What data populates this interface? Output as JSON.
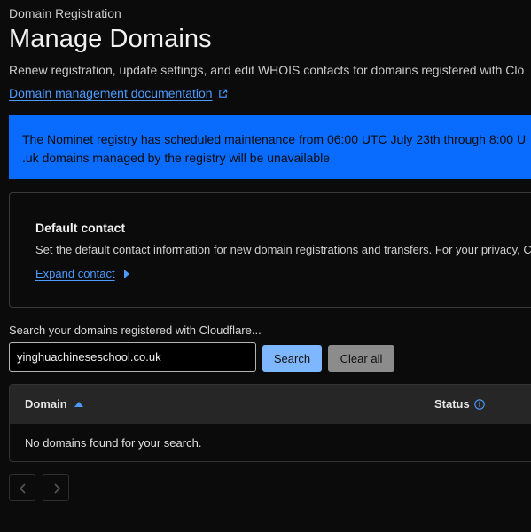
{
  "header": {
    "breadcrumb": "Domain Registration",
    "title": "Manage Domains",
    "description": "Renew registration, update settings, and edit WHOIS contacts for domains registered with Clo",
    "doc_link": "Domain management documentation",
    "doc_link_icon": "external-link-icon"
  },
  "banner": {
    "line1": "The Nominet registry has scheduled maintenance from 06:00 UTC July 23th through 8:00 U",
    "line2": ".uk domains managed by the registry will be unavailable",
    "color": "#0a6cff"
  },
  "default_contact": {
    "heading": "Default contact",
    "text": "Set the default contact information for new domain registrations and transfers. For your privacy, Clou",
    "expand_label": "Expand contact",
    "expand_icon": "caret-right-icon"
  },
  "search": {
    "label": "Search your domains registered with Cloudflare...",
    "value": "yinghuachineseschool.co.uk",
    "search_button": "Search",
    "clear_button": "Clear all"
  },
  "table": {
    "columns": [
      "Domain",
      "Status"
    ],
    "sort_icon": "sort-ascending-icon",
    "status_icon": "info-icon",
    "empty_message": "No domains found for your search."
  },
  "pagination": {
    "prev_icon": "chevron-left-icon",
    "next_icon": "chevron-right-icon"
  },
  "colors": {
    "accent": "#4d9bff",
    "background": "#0b0b0b"
  }
}
